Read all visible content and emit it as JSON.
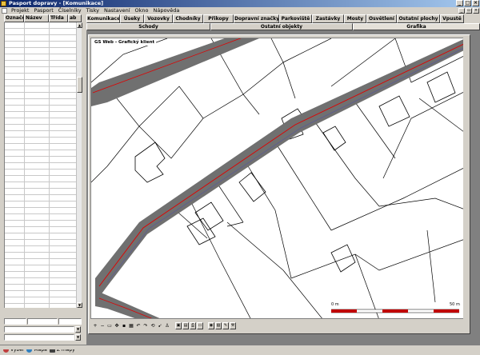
{
  "window": {
    "title": "Pasport dopravy - [Komunikace]"
  },
  "menu": [
    "Projekt",
    "Pasport",
    "Číselníky",
    "Tisky",
    "Nastavení",
    "Okno",
    "Nápověda"
  ],
  "grid": {
    "columns": [
      "Označení",
      "Název",
      "Třída",
      "ab"
    ]
  },
  "left_tabs": [
    {
      "label": "Výběr",
      "icon": "selection-icon",
      "color": "#c04040"
    },
    {
      "label": "Mapa",
      "icon": "globe-icon",
      "color": "#3080c0"
    },
    {
      "label": "Z mapy",
      "icon": "map-pointer-icon",
      "color": "#404040"
    }
  ],
  "tabs_row1": [
    "Komunikace",
    "Úseky",
    "Vozovky",
    "Chodníky",
    "Přikopy",
    "Dopravní značky",
    "Parkoviště",
    "Zastávky",
    "Mosty",
    "Osvětlení",
    "Ostatní plochy",
    "Vpustě"
  ],
  "tabs_row2": [
    "Schody",
    "Ostatní objekty",
    "Grafika"
  ],
  "active_tab_row2": "Grafika",
  "map": {
    "window_title": "GS Web - Grafický klient",
    "scale_start": "0 m",
    "scale_end": "50 m",
    "road_color": "#707070",
    "road_line_color": "#e00000"
  }
}
